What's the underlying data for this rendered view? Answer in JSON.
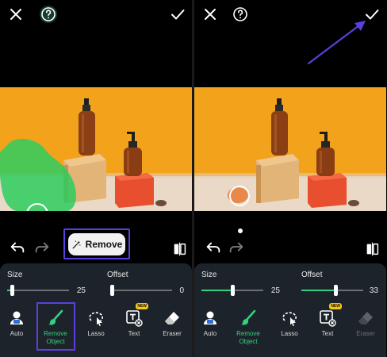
{
  "left": {
    "actions": {
      "remove_label": "Remove"
    },
    "size": {
      "label": "Size",
      "value": "25",
      "fraction": 0.08
    },
    "offset": {
      "label": "Offset",
      "value": "0",
      "fraction": 0.0
    },
    "tools": [
      {
        "icon": "auto-icon",
        "label": "Auto"
      },
      {
        "icon": "brush-icon",
        "label": "Remove\nObject"
      },
      {
        "icon": "lasso-icon",
        "label": "Lasso"
      },
      {
        "icon": "text-icon",
        "label": "Text",
        "badge": "NEW"
      },
      {
        "icon": "eraser-icon",
        "label": "Eraser"
      }
    ]
  },
  "right": {
    "size": {
      "label": "Size",
      "value": "25",
      "fraction": 0.5
    },
    "offset": {
      "label": "Offset",
      "value": "33",
      "fraction": 0.55
    },
    "tools": [
      {
        "icon": "auto-icon",
        "label": "Auto"
      },
      {
        "icon": "brush-icon",
        "label": "Remove\nObject"
      },
      {
        "icon": "lasso-icon",
        "label": "Lasso"
      },
      {
        "icon": "text-icon",
        "label": "Text",
        "badge": "NEW"
      },
      {
        "icon": "eraser-icon",
        "label": "Eraser"
      }
    ]
  },
  "colors": {
    "accent": "#35d07f",
    "highlight": "#5b3fe0",
    "sheet": "#1d232a",
    "backdrop": "#f3a21c"
  }
}
